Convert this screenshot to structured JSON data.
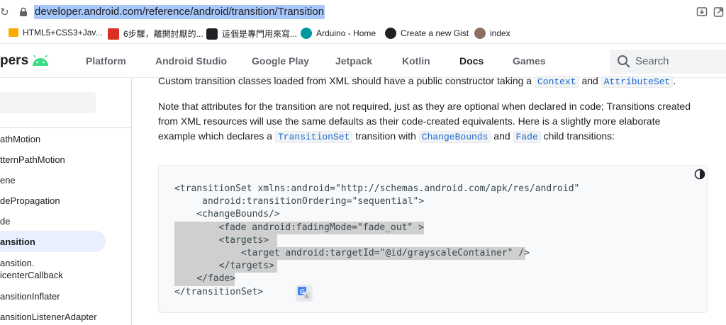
{
  "browser": {
    "url": "developer.android.com/reference/android/transition/Transition"
  },
  "bookmarks": [
    {
      "label": "HTML5+CSS3+Jav...",
      "icon": "folder-icon",
      "color": "#f9ab00"
    },
    {
      "label": "6步驟，離開討厭的...",
      "icon": "site-logo-icon",
      "color": "#d93025"
    },
    {
      "label": "這個是專門用來寫...",
      "icon": "medium-icon",
      "color": "#202124"
    },
    {
      "label": "Arduino - Home",
      "icon": "arduino-icon",
      "color": "#00979d"
    },
    {
      "label": "Create a new Gist",
      "icon": "github-icon",
      "color": "#202124"
    },
    {
      "label": "index",
      "icon": "avatar-icon",
      "color": "#8d6e63"
    }
  ],
  "header": {
    "brand": "pers",
    "nav": [
      "Platform",
      "Android Studio",
      "Google Play",
      "Jetpack",
      "Kotlin",
      "Docs",
      "Games"
    ],
    "active_nav": "Docs",
    "search_placeholder": "Search"
  },
  "sidebar": {
    "items": [
      "athMotion",
      "tternPathMotion",
      "ene",
      "dePropagation",
      "de",
      "ansition",
      "ansition.",
      "icenterCallback",
      "ansitionInflater",
      "ansitionListenerAdapter"
    ],
    "active_item": "ansition"
  },
  "content": {
    "p1_before": "Custom transition classes loaded from XML should have a public constructor taking a ",
    "p1_code1": "Context",
    "p1_mid": " and ",
    "p1_code2": "AttributeSet",
    "p1_after": ".",
    "p2_a": "Note that attributes for the transition are not required, just as they are optional when declared in code; Transitions created from XML resources will use the same defaults as their code-created equivalents. Here is a slightly more elaborate example which declares a ",
    "p2_code1": "TransitionSet",
    "p2_b": " transition with ",
    "p2_code2": "ChangeBounds",
    "p2_c": " and ",
    "p2_code3": "Fade",
    "p2_d": " child transitions:"
  },
  "code": {
    "lines": [
      "<transitionSet xmlns:android=\"http://schemas.android.com/apk/res/android\"",
      "     android:transitionOrdering=\"sequential\">",
      "    <changeBounds/>",
      "    <fade android:fadingMode=\"fade_out\" >",
      "        <targets>",
      "            <target android:targetId=\"@id/grayscaleContainer\" />",
      "        </targets>",
      "    </fade>",
      "</transitionSet>"
    ]
  },
  "colors": {
    "link_blue": "#1967d2",
    "android_green": "#3ddc84",
    "selection": "#a8c7fa"
  }
}
